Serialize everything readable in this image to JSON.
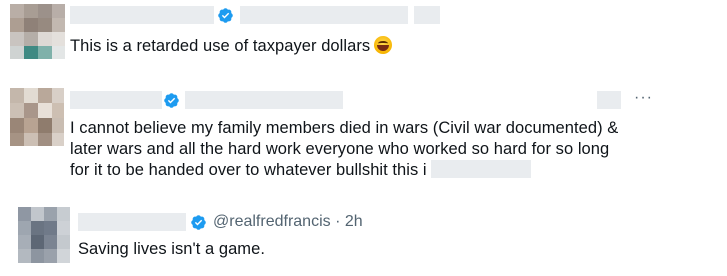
{
  "colors": {
    "verified_badge": "#1d9bf0",
    "text_primary": "#0f1419",
    "text_secondary": "#536471",
    "redaction": "#e9ecef"
  },
  "replies": [
    {
      "display_name": "",
      "handle": "",
      "verified": true,
      "text": "This is a retarded use of taxpayer dollars",
      "emoji": "laughing-crying-face"
    },
    {
      "display_name": "",
      "handle": "",
      "verified": true,
      "more_label": "···",
      "lines": [
        "I cannot believe my family members died in wars (Civil war documented) &",
        "later wars and all the hard work everyone who worked so hard for so long",
        "for it to be handed over to whatever bullshit this i"
      ]
    },
    {
      "display_name": "",
      "handle": "@realfredfrancis",
      "separator": "·",
      "time": "2h",
      "verified": true,
      "text": "Saving lives isn't a game."
    }
  ]
}
